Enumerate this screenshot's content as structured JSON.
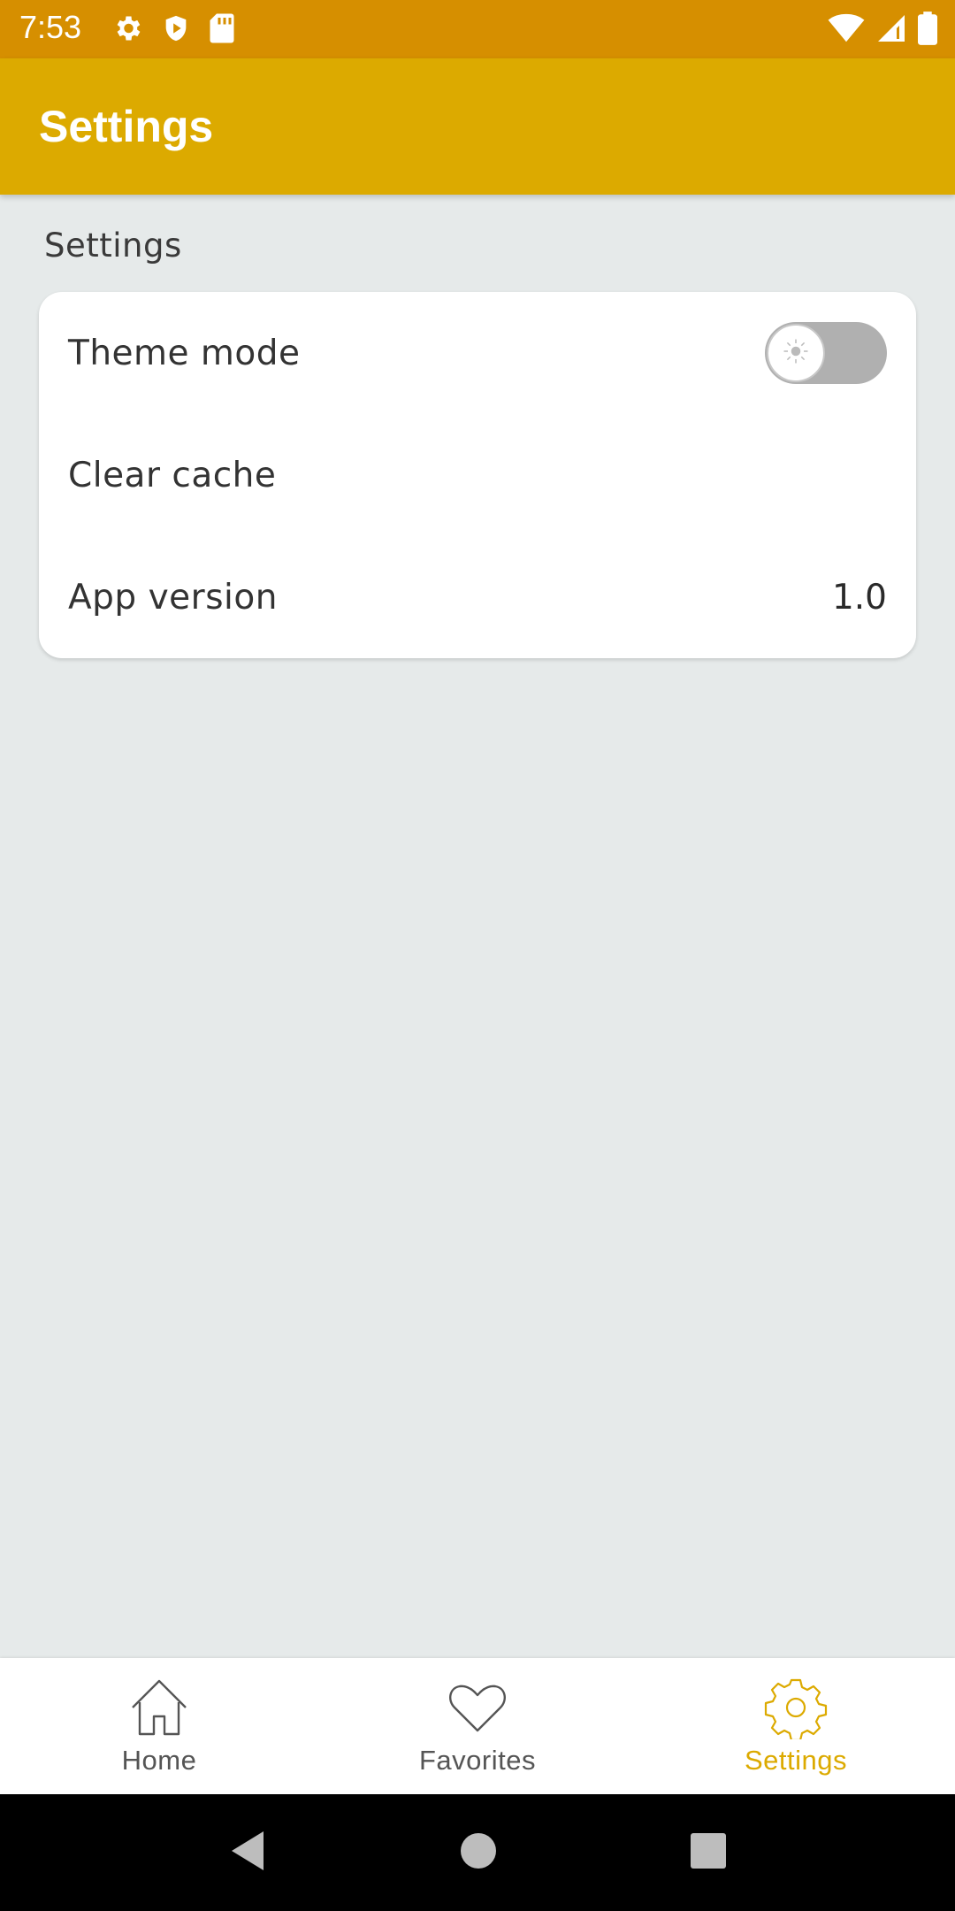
{
  "status_bar": {
    "time": "7:53",
    "left_icons": [
      "gear-icon",
      "shield-icon",
      "sd-card-icon"
    ],
    "right_icons": [
      "wifi-icon",
      "signal-icon",
      "battery-icon"
    ],
    "background": "#d68f00"
  },
  "app_bar": {
    "title": "Settings",
    "background": "#dcaa00"
  },
  "section": {
    "header": "Settings"
  },
  "settings": {
    "theme_mode": {
      "label": "Theme mode",
      "toggle_on": false,
      "knob_icon": "sun-icon"
    },
    "clear_cache": {
      "label": "Clear cache"
    },
    "app_version": {
      "label": "App version",
      "value": "1.0"
    }
  },
  "bottom_nav": {
    "items": [
      {
        "label": "Home",
        "icon": "home-icon",
        "active": false
      },
      {
        "label": "Favorites",
        "icon": "heart-icon",
        "active": false
      },
      {
        "label": "Settings",
        "icon": "gear-icon",
        "active": true
      }
    ],
    "active_color": "#dcaa00"
  },
  "system_nav": {
    "buttons": [
      "back-icon",
      "home-circle-icon",
      "recents-icon"
    ]
  }
}
